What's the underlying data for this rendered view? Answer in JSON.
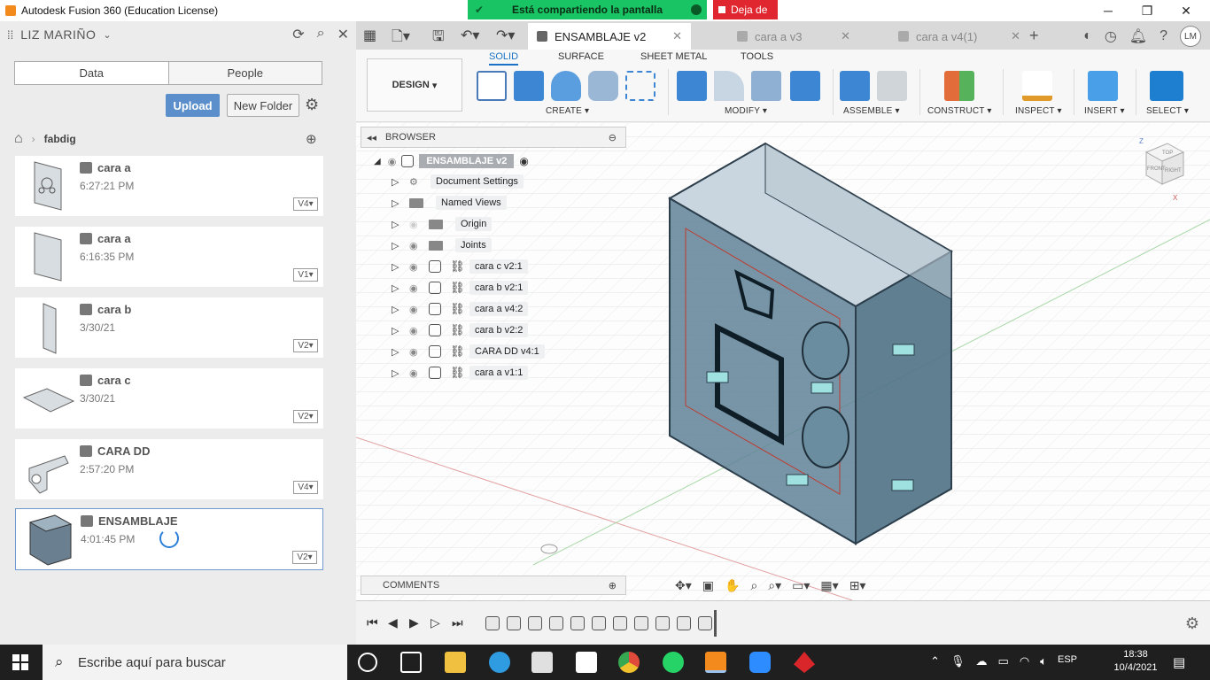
{
  "window": {
    "title": "Autodesk Fusion 360 (Education License)"
  },
  "share": {
    "sharing_text": "Está compartiendo la pantalla",
    "stop_text": "Deja de"
  },
  "data_panel": {
    "user": "LIZ MARIÑO",
    "tabs": [
      "Data",
      "People"
    ],
    "upload": "Upload",
    "new_folder": "New Folder",
    "breadcrumb": "fabdig",
    "files": [
      {
        "name": "cara a",
        "time": "6:27:21 PM",
        "version": "V4"
      },
      {
        "name": "cara a",
        "time": "6:16:35 PM",
        "version": "V1"
      },
      {
        "name": "cara b",
        "time": "3/30/21",
        "version": "V2"
      },
      {
        "name": "cara c",
        "time": "3/30/21",
        "version": "V2"
      },
      {
        "name": "CARA DD",
        "time": "2:57:20 PM",
        "version": "V4"
      },
      {
        "name": "ENSAMBLAJE",
        "time": "4:01:45 PM",
        "version": "V2"
      }
    ]
  },
  "doc_tabs": [
    {
      "label": "ENSAMBLAJE v2",
      "active": true
    },
    {
      "label": "cara a v3"
    },
    {
      "label": "cara a v4(1)"
    }
  ],
  "user_initials": "LM",
  "toolbar": {
    "workspace": "DESIGN",
    "tabs": [
      "SOLID",
      "SURFACE",
      "SHEET METAL",
      "TOOLS"
    ],
    "groups": [
      "CREATE",
      "MODIFY",
      "ASSEMBLE",
      "CONSTRUCT",
      "INSPECT",
      "INSERT",
      "SELECT"
    ]
  },
  "browser": {
    "title": "BROWSER",
    "root": "ENSAMBLAJE v2",
    "items": [
      {
        "label": "Document Settings"
      },
      {
        "label": "Named Views"
      },
      {
        "label": "Origin"
      },
      {
        "label": "Joints"
      },
      {
        "label": "cara c v2:1"
      },
      {
        "label": "cara b v2:1"
      },
      {
        "label": "cara a v4:2"
      },
      {
        "label": "cara b v2:2"
      },
      {
        "label": "CARA DD v4:1"
      },
      {
        "label": "cara a v1:1"
      }
    ]
  },
  "viewcube": {
    "top": "TOP",
    "front": "FRONT",
    "right": "RIGHT",
    "z": "Z",
    "x": "X"
  },
  "comments": "COMMENTS",
  "taskbar": {
    "search_placeholder": "Escribe aquí para buscar",
    "lang": "ESP",
    "time": "18:38",
    "date": "10/4/2021"
  },
  "colors": {
    "accent": "#1a73c6",
    "share_green": "#19c465",
    "stop_red": "#e0262e"
  }
}
